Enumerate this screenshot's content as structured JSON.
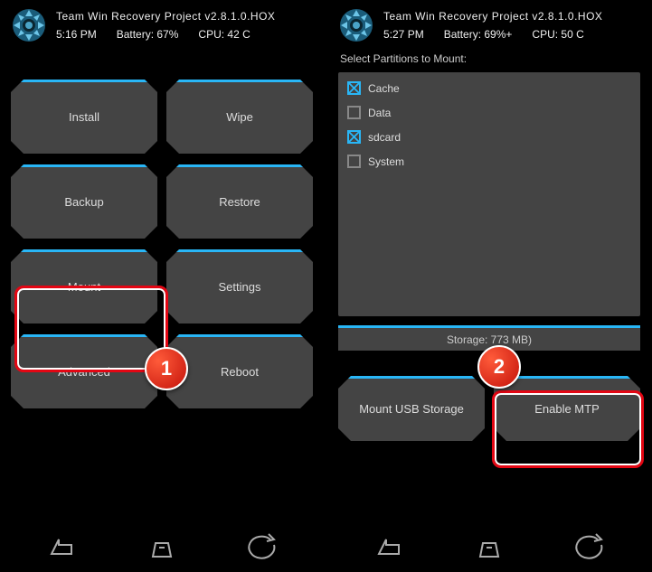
{
  "left": {
    "title": "Team Win Recovery Project  v2.8.1.0.HOX",
    "time": "5:16 PM",
    "battery": "Battery: 67%",
    "cpu": "CPU: 42 C",
    "menu": {
      "install": "Install",
      "wipe": "Wipe",
      "backup": "Backup",
      "restore": "Restore",
      "mount": "Mount",
      "settings": "Settings",
      "advanced": "Advanced",
      "reboot": "Reboot"
    },
    "badge": "1"
  },
  "right": {
    "title": "Team Win Recovery Project  v2.8.1.0.HOX",
    "time": "5:27 PM",
    "battery": "Battery: 69%+",
    "cpu": "CPU: 50 C",
    "subtitle": "Select Partitions to Mount:",
    "partitions": [
      {
        "label": "Cache",
        "checked": true
      },
      {
        "label": "Data",
        "checked": false
      },
      {
        "label": "sdcard",
        "checked": true
      },
      {
        "label": "System",
        "checked": false
      }
    ],
    "storage": "Storage:               773 MB)",
    "mount_usb": "Mount USB Storage",
    "enable_mtp": "Enable MTP",
    "badge": "2"
  }
}
